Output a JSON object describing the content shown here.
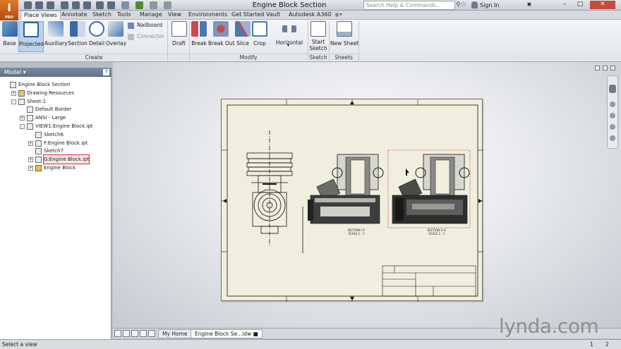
{
  "app": {
    "logo": "I",
    "logo_sub": "PRO",
    "title": "Engine Block Section"
  },
  "search": {
    "placeholder": "Search Help & Commands..."
  },
  "account": {
    "sign_in": "Sign In"
  },
  "ribbon_tabs": [
    "Place Views",
    "Annotate",
    "Sketch",
    "Tools",
    "Manage",
    "View",
    "Environments",
    "Get Started",
    "Vault",
    "Autodesk A360"
  ],
  "ribbon": {
    "create": {
      "label": "Create",
      "buttons": [
        "Base",
        "Projected",
        "Auxiliary",
        "Section",
        "Detail",
        "Overlay"
      ],
      "small": [
        "Nailboard",
        "Connector"
      ]
    },
    "modify": {
      "label": "Modify",
      "buttons": [
        "Draft",
        "Break",
        "Break Out",
        "Slice",
        "Crop",
        "Horizontal"
      ]
    },
    "sketch": {
      "label": "Sketch",
      "buttons": [
        "Start",
        "Sketch"
      ]
    },
    "sheets": {
      "label": "Sheets",
      "buttons": [
        "New Sheet"
      ]
    }
  },
  "browser": {
    "title": "Model",
    "help": "?",
    "tree": [
      {
        "label": "Engine Block Section",
        "indent": 0,
        "exp": ""
      },
      {
        "label": "Drawing Resources",
        "indent": 1,
        "exp": "+"
      },
      {
        "label": "Sheet:1",
        "indent": 1,
        "exp": "-"
      },
      {
        "label": "Default Border",
        "indent": 2,
        "exp": ""
      },
      {
        "label": "ANSI - Large",
        "indent": 2,
        "exp": "+"
      },
      {
        "label": "VIEW1:Engine Block.ipt",
        "indent": 2,
        "exp": "-"
      },
      {
        "label": "Sketch6",
        "indent": 3,
        "exp": ""
      },
      {
        "label": "F:Engine Block.ipt",
        "indent": 3,
        "exp": "+"
      },
      {
        "label": "Sketch7",
        "indent": 3,
        "exp": ""
      },
      {
        "label": "G:Engine Block.ipt",
        "indent": 3,
        "exp": "+",
        "highlight": true
      },
      {
        "label": "Engine Block",
        "indent": 3,
        "exp": "+"
      }
    ]
  },
  "drawing": {
    "section_f": {
      "title": "SECTION F-F",
      "scale": "SCALE 2 : 1"
    },
    "section_g": {
      "title": "SECTION G-G",
      "scale": "SCALE 2 : 1"
    }
  },
  "document_tabs": [
    "My Home",
    "Engine Block Se...idw"
  ],
  "status": {
    "text": "Select a view",
    "pages": [
      "1",
      "2"
    ]
  },
  "watermark": "lynda.com"
}
